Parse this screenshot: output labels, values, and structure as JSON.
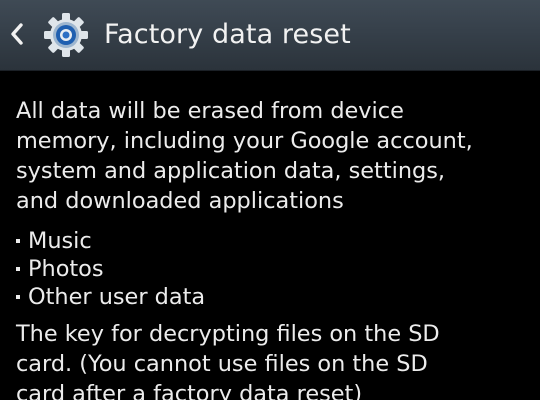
{
  "header": {
    "title": "Factory data reset",
    "back_icon": "back-chevron-icon",
    "app_icon": "settings-gear-icon"
  },
  "body": {
    "warning_lines": [
      "All data will be erased from device",
      "memory, including your Google account,",
      "system and application data, settings,",
      "and downloaded applications"
    ],
    "items": [
      "Music",
      "Photos",
      "Other user data"
    ],
    "note_lines": [
      "The key for decrypting files on the SD",
      "card. (You cannot use files on the SD",
      "card after a factory data reset)"
    ]
  },
  "colors": {
    "action_bar": "#36404a",
    "background": "#000000",
    "text": "#ececec",
    "gear_accent": "#1f5fb0"
  }
}
